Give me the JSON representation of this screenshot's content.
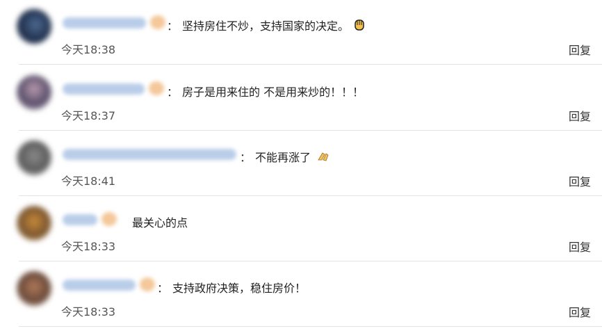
{
  "comments": [
    {
      "text": "坚持房住不炒，支持国家的决定。",
      "emoji": "raised-hand-icon",
      "time": "今天18:38",
      "reply": "回复"
    },
    {
      "text": "房子是用来住的 不是用来炒的！！！",
      "time": "今天18:37",
      "reply": "回复"
    },
    {
      "text": "不能再涨了",
      "emoji": "pinched-fingers-icon",
      "time": "今天18:41",
      "reply": "回复"
    },
    {
      "text": "最关心的点",
      "time": "今天18:33",
      "reply": "回复"
    },
    {
      "text": "支持政府决策，稳住房价！",
      "time": "今天18:33",
      "reply": "回复"
    }
  ],
  "colon": "："
}
